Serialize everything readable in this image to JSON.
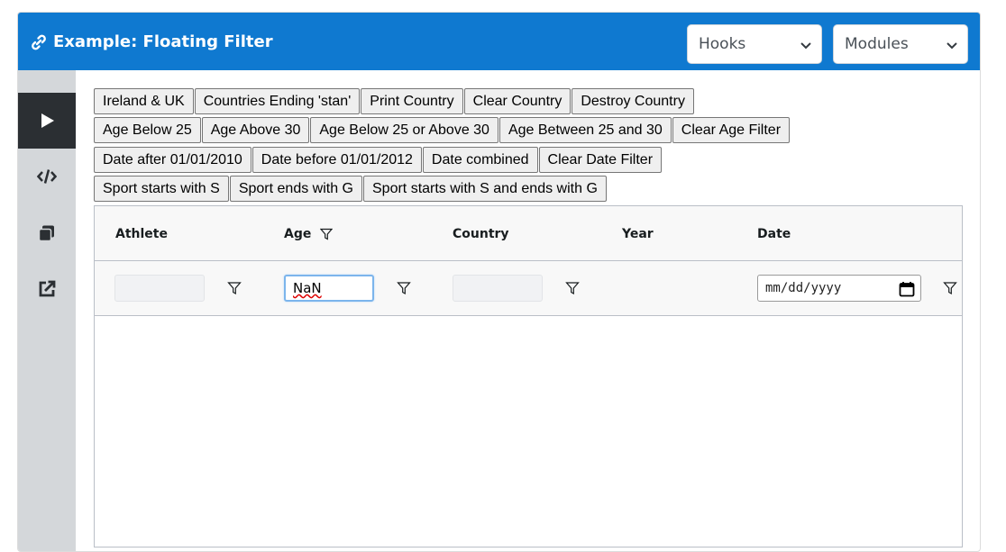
{
  "header": {
    "title": "Example: Floating Filter",
    "selects": [
      {
        "value": "Hooks"
      },
      {
        "value": "Modules"
      }
    ]
  },
  "sidebar": {
    "items": [
      {
        "icon": "play-icon"
      },
      {
        "icon": "code-icon"
      },
      {
        "icon": "copy-icon"
      },
      {
        "icon": "external-link-icon"
      }
    ]
  },
  "buttons": {
    "row1": [
      "Ireland & UK",
      "Countries Ending 'stan'",
      "Print Country",
      "Clear Country",
      "Destroy Country"
    ],
    "row2": [
      "Age Below 25",
      "Age Above 30",
      "Age Below 25 or Above 30",
      "Age Between 25 and 30",
      "Clear Age Filter"
    ],
    "row3": [
      "Date after 01/01/2010",
      "Date before 01/01/2012",
      "Date combined",
      "Clear Date Filter"
    ],
    "row4": [
      "Sport starts with S",
      "Sport ends with G",
      "Sport starts with S and ends with G"
    ]
  },
  "grid": {
    "columns": [
      "Athlete",
      "Age",
      "Country",
      "Year",
      "Date"
    ],
    "filters": {
      "athlete": "",
      "age": "NaN",
      "country": "",
      "date_placeholder": "mm/dd/yyyy"
    }
  },
  "colors": {
    "header_bg": "#0f79d0",
    "sidebar_bg": "#d4d7da",
    "sidebar_active": "#2b2f33"
  }
}
